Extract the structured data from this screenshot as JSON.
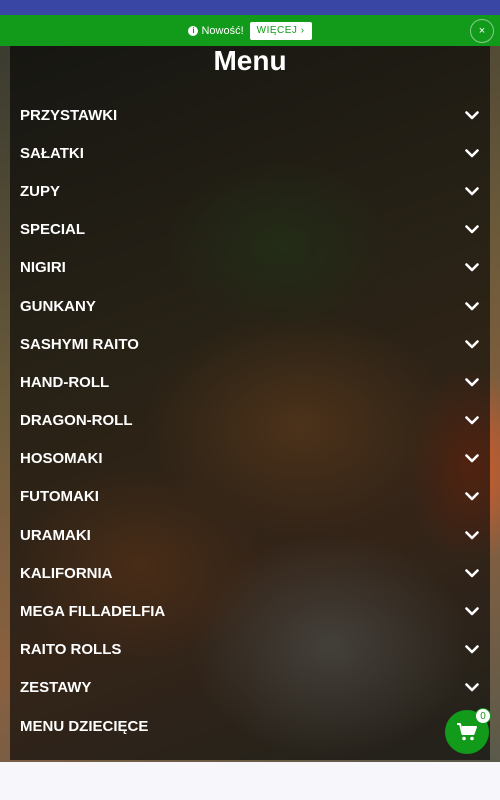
{
  "notice": {
    "text": "Nowość!",
    "more_label": "WIĘCEJ ›",
    "close_label": "×"
  },
  "page": {
    "title": "Menu"
  },
  "menu": {
    "items": [
      {
        "label": "PRZYSTAWKI",
        "has_dropdown": true
      },
      {
        "label": "SAŁATKI",
        "has_dropdown": true
      },
      {
        "label": "ZUPY",
        "has_dropdown": true
      },
      {
        "label": "SPECIAL",
        "has_dropdown": true
      },
      {
        "label": "NIGIRI",
        "has_dropdown": true
      },
      {
        "label": "GUNKANY",
        "has_dropdown": true
      },
      {
        "label": "SASHYMI RAITO",
        "has_dropdown": true
      },
      {
        "label": "HAND-ROLL",
        "has_dropdown": true
      },
      {
        "label": "DRAGON-ROLL",
        "has_dropdown": true
      },
      {
        "label": "HOSOMAKI",
        "has_dropdown": true
      },
      {
        "label": "FUTOMAKI",
        "has_dropdown": true
      },
      {
        "label": "URAMAKI",
        "has_dropdown": true
      },
      {
        "label": "KALIFORNIA",
        "has_dropdown": true
      },
      {
        "label": "MEGA FILLADELFIA",
        "has_dropdown": true
      },
      {
        "label": "RAITO ROLLS",
        "has_dropdown": true
      },
      {
        "label": "ZESTAWY",
        "has_dropdown": true
      },
      {
        "label": "MENU DZIECIĘCE",
        "has_dropdown": false
      }
    ]
  },
  "cart": {
    "count": "0",
    "icon": "cart-icon"
  },
  "colors": {
    "brand_green": "#129a1a",
    "topbar_blue": "#3a46a3"
  }
}
